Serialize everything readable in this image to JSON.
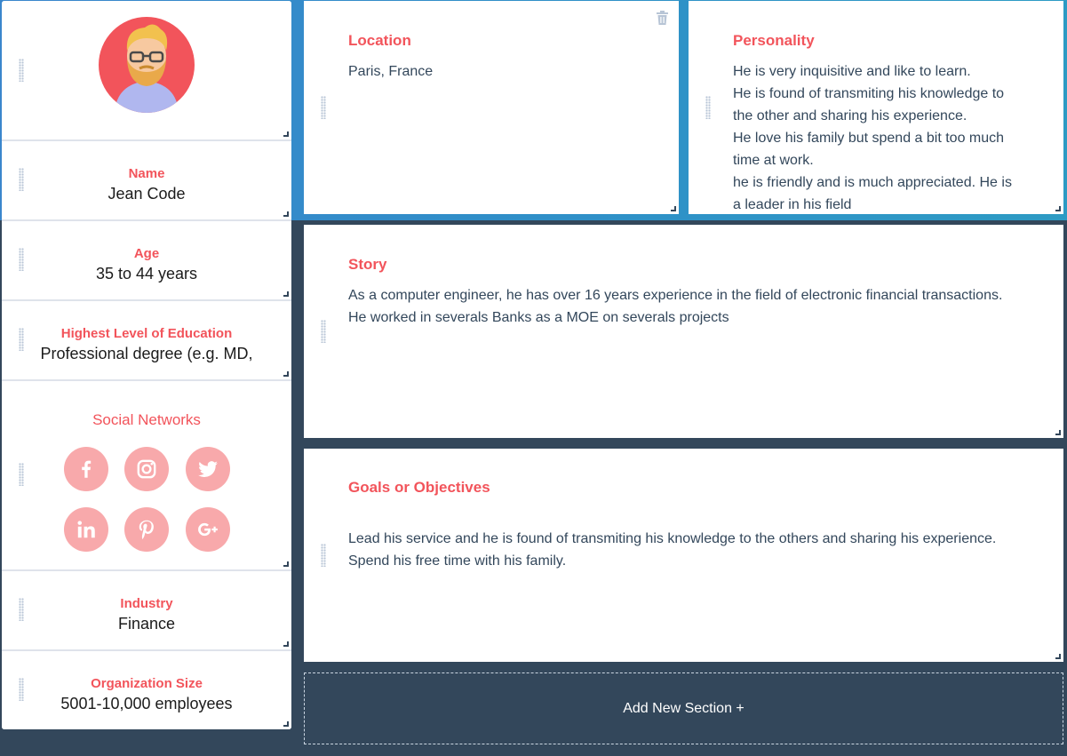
{
  "profile": {
    "name_label": "Name",
    "name_value": "Jean Code",
    "age_label": "Age",
    "age_value": "35 to 44 years",
    "education_label": "Highest Level of Education",
    "education_value": "Professional degree (e.g. MD,",
    "social_label": "Social Networks",
    "social_icons": [
      "facebook-icon",
      "instagram-icon",
      "twitter-icon",
      "linkedin-icon",
      "pinterest-icon",
      "google-plus-icon"
    ],
    "industry_label": "Industry",
    "industry_value": "Finance",
    "org_size_label": "Organization Size",
    "org_size_value": "5001-10,000 employees"
  },
  "location": {
    "title": "Location",
    "text": "Paris, France"
  },
  "personality": {
    "title": "Personality",
    "lines": [
      "He is very inquisitive and like to learn.",
      "He is found of transmiting his knowledge to",
      "the other and sharing his experience.",
      "He love his family but spend a bit too much",
      "time at work.",
      "he is friendly and is much appreciated. He is",
      "a leader in his field"
    ]
  },
  "story": {
    "title": "Story",
    "lines": [
      "As a computer engineer, he has over 16 years experience in the field of electronic financial transactions.",
      "He worked in severals Banks as a MOE on severals projects"
    ]
  },
  "goals": {
    "title": "Goals or Objectives",
    "lines": [
      "Lead his service and he is found of transmiting his knowledge to the others and sharing his experience.",
      "Spend his free time with his family."
    ]
  },
  "add_section_label": "Add New Section +",
  "colors": {
    "accent": "#f2545b",
    "dark_bg": "#33475b",
    "social_bg": "#f8a9ab",
    "blue_bg": "#3a86cc"
  }
}
